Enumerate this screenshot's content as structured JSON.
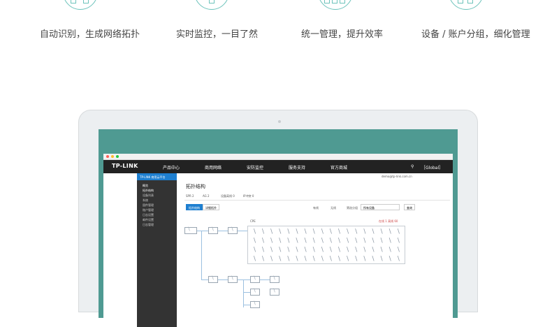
{
  "features": [
    {
      "icon": "topology-icon",
      "label": "自动识别，生成网络拓扑"
    },
    {
      "icon": "monitor-icon",
      "label": "实时监控，一目了然"
    },
    {
      "icon": "devices-icon",
      "label": "统一管理，提升效率"
    },
    {
      "icon": "groups-icon",
      "label": "设备 / 账户分组，细化管理"
    }
  ],
  "browser": {
    "logo": "TP-LINK",
    "nav": [
      "产品中心",
      "商用网络",
      "安防监控",
      "服务支持",
      "官方商城"
    ],
    "region": "［Global］"
  },
  "sidebar": {
    "title": "TP-LINK 商用云平台",
    "items": [
      "概览",
      "拓扑结构",
      "设备列表",
      "系统",
      "固件管理",
      "账户管理",
      "日志设置",
      "邮件设置",
      "日志管理"
    ]
  },
  "app": {
    "page_title": "拓扑结构",
    "stats": [
      "SPR 2",
      "AG 2",
      "设备离线 0",
      "IP冲突 0"
    ],
    "user": "demo@tp-link.com.cn",
    "tabs": [
      "拓扑结构",
      "详细拓扑"
    ],
    "legend": [
      "有线",
      "无线"
    ],
    "filter_label": "筛选分组",
    "filter_value": "所有设备",
    "filter_btn": "查询",
    "grid_label": "CPE",
    "grid_stats": "在线 1  离线 60"
  },
  "colors": {
    "accent": "#1e7fd0",
    "teal": "#4f9a92",
    "nav": "#222222"
  }
}
